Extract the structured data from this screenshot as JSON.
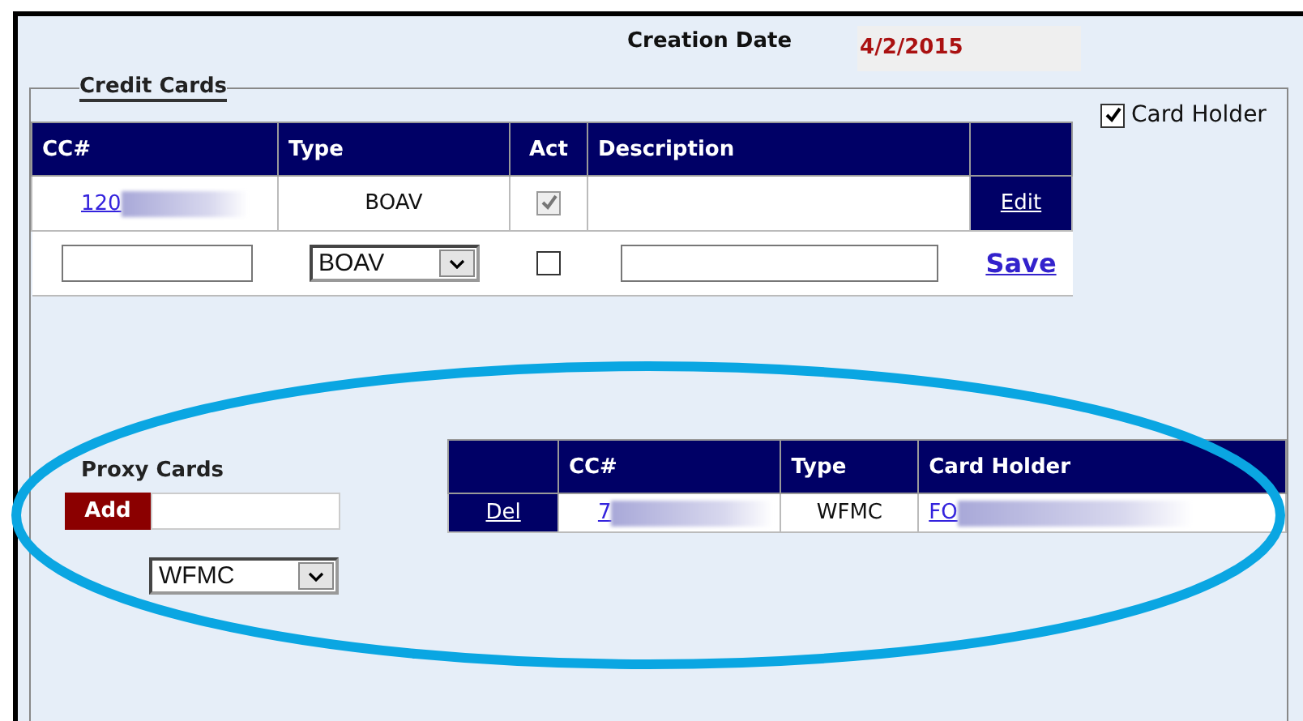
{
  "header": {
    "creation_date_label": "Creation Date",
    "creation_date": "4/2/2015"
  },
  "credit_cards": {
    "legend": "Credit Cards",
    "card_holder": {
      "label": "Card Holder",
      "checked": true
    },
    "columns": [
      "CC#",
      "Type",
      "Act",
      "Description"
    ],
    "rows": [
      {
        "cc": "120",
        "type": "BOAV",
        "active": true,
        "action": "Edit"
      }
    ],
    "new_row": {
      "type": "BOAV",
      "active": false,
      "action": "Save"
    }
  },
  "proxy_cards": {
    "label": "Proxy Cards",
    "add_button": "Add",
    "type": "WFMC",
    "columns": [
      "CC#",
      "Type",
      "Card Holder"
    ],
    "rows": [
      {
        "action": "Del",
        "cc": "7",
        "type": "WFMC",
        "card_holder": "FO"
      }
    ]
  }
}
